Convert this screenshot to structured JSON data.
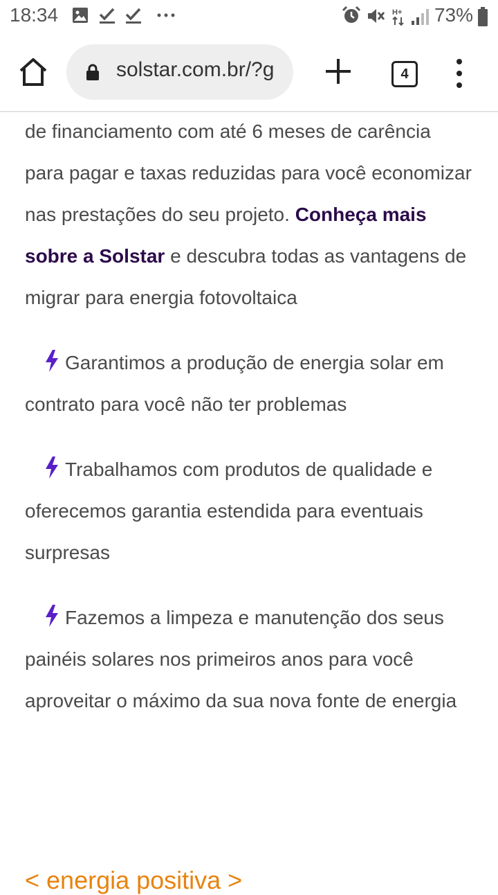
{
  "status_bar": {
    "time": "18:34",
    "battery": "73%",
    "icons_left": [
      "image-icon",
      "check-download-icon",
      "check-download-icon",
      "more-dots-icon"
    ],
    "icons_right": [
      "alarm-icon",
      "mute-icon",
      "network-hplus-icon",
      "signal-icon",
      "battery-icon"
    ]
  },
  "browser": {
    "url": "solstar.com.br/?g",
    "tab_count": "4"
  },
  "article": {
    "intro_before_link": "de financiamento com até 6 meses de carência para pagar e taxas reduzidas para você economizar nas prestações do seu projeto. ",
    "link_text": "Conheça mais sobre a Solstar",
    "intro_after_link": " e descubra todas as vantagens de migrar para energia fotovoltaica",
    "benefits": [
      {
        "icon": "lightning-bolt-icon",
        "text": "Garantimos a produção de energia solar em contrato para você não ter problemas"
      },
      {
        "icon": "lightning-bolt-icon",
        "text": "Trabalhamos com produtos de qualidade e oferecemos garantia estendida para eventuais surpresas"
      },
      {
        "icon": "lightning-bolt-icon",
        "text": "Fazemos a limpeza e manutenção dos seus painéis solares nos primeiros anos para você aproveitar o máximo da sua nova fonte de energia"
      }
    ],
    "footer_link": "< energia positiva >"
  },
  "colors": {
    "link": "#2c0a4a",
    "bolt": "#5a1fc9",
    "footer_link": "#e8830f",
    "body_text": "#4a4a4a"
  }
}
